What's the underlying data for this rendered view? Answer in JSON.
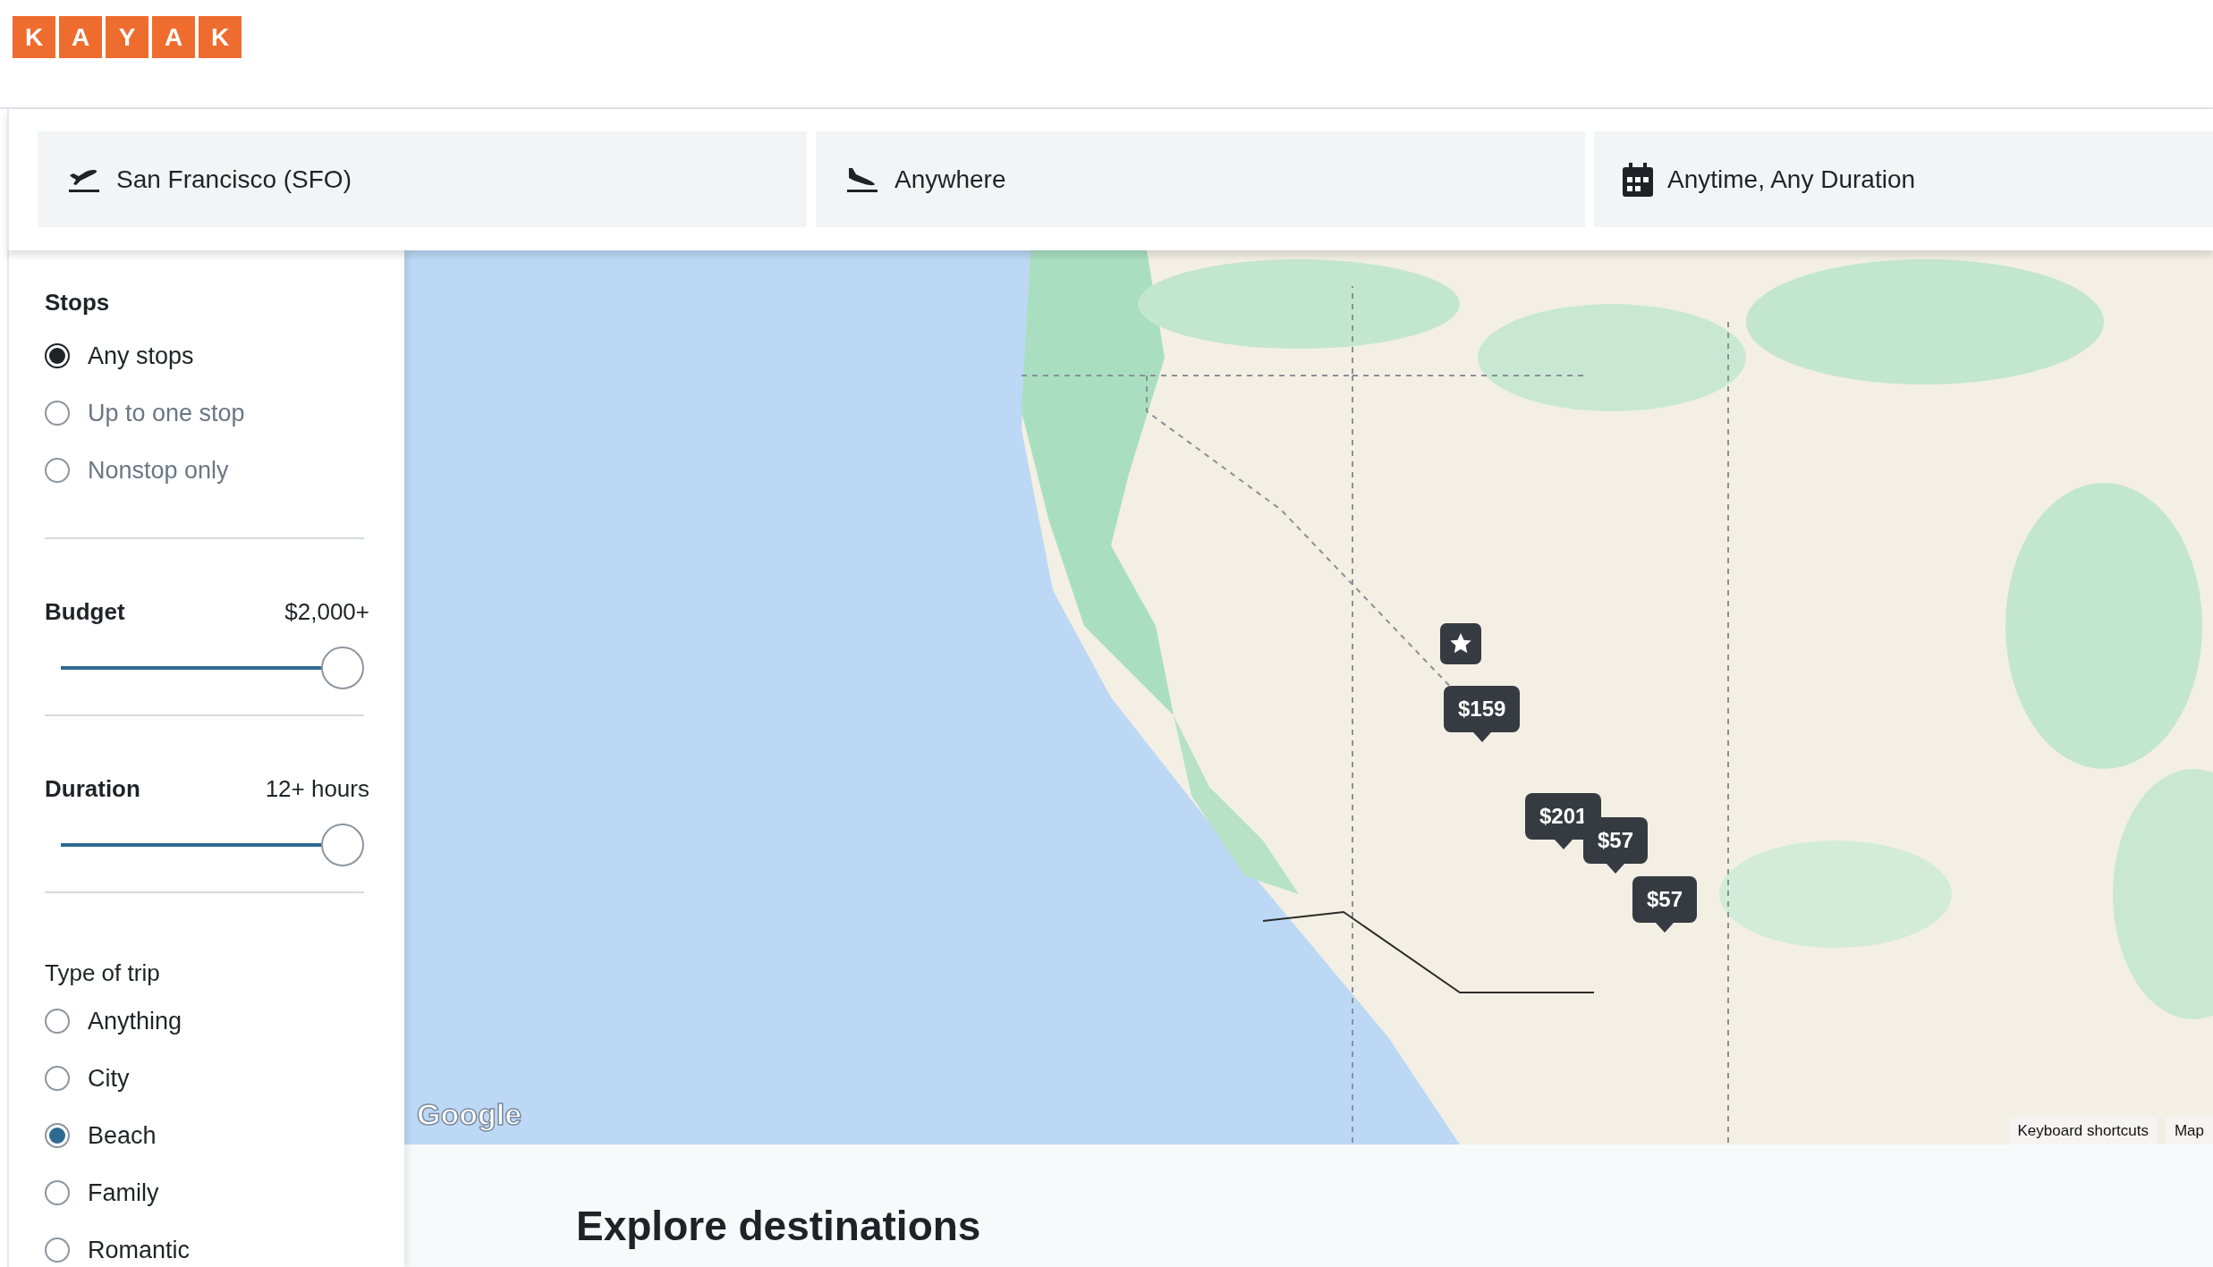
{
  "logo": {
    "letters": [
      "K",
      "A",
      "Y",
      "A",
      "K"
    ]
  },
  "search": [
    {
      "kind": "origin",
      "value": "San Francisco (SFO)"
    },
    {
      "kind": "destination",
      "value": "Anywhere"
    },
    {
      "kind": "dates",
      "value": "Anytime, Any Duration"
    }
  ],
  "filters": {
    "stops": {
      "title": "Stops",
      "options": [
        {
          "label": "Any stops",
          "selected": true
        },
        {
          "label": "Up to one stop",
          "selected": false
        },
        {
          "label": "Nonstop only",
          "selected": false
        }
      ]
    },
    "sliders": [
      {
        "title": "Budget",
        "reading": "$2,000+",
        "level": 1
      },
      {
        "title": "Duration",
        "reading": "12+ hours",
        "level": 1
      }
    ],
    "trip_type": {
      "title": "Type of trip",
      "options": [
        {
          "label": "Anything",
          "selected": false
        },
        {
          "label": "City",
          "selected": false
        },
        {
          "label": "Beach",
          "selected": true
        },
        {
          "label": "Family",
          "selected": false
        },
        {
          "label": "Romantic",
          "selected": false
        }
      ]
    }
  },
  "map": {
    "kind": "picture",
    "price_markers": [
      {
        "price": "$159"
      },
      {
        "price": "$201"
      },
      {
        "price": "$57"
      },
      {
        "price": "$57"
      }
    ],
    "attribution": "Google",
    "footer_links": [
      "Keyboard shortcuts",
      "Map"
    ]
  },
  "explore": {
    "title": "Explore destinations"
  }
}
